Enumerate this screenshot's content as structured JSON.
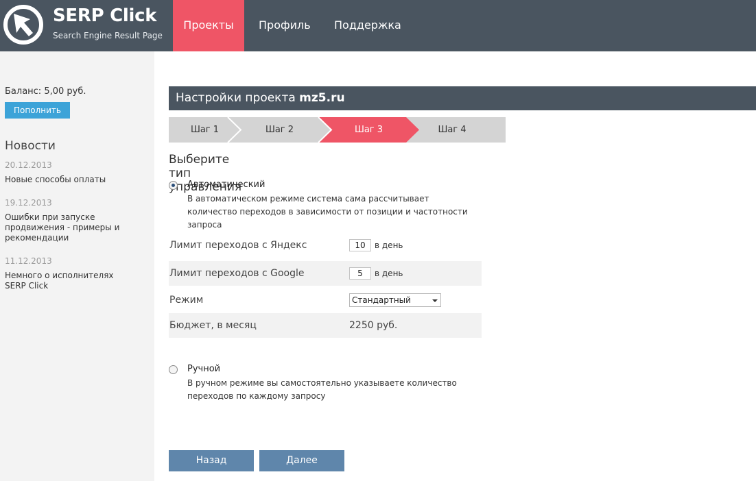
{
  "header": {
    "logo_title": "SERP Click",
    "logo_subtitle": "Search Engine Result Page",
    "nav": [
      {
        "label": "Проекты",
        "active": true
      },
      {
        "label": "Профиль",
        "active": false
      },
      {
        "label": "Поддержка",
        "active": false
      }
    ]
  },
  "sidebar": {
    "balance": "Баланс:  5,00 руб.",
    "topup_label": "Пополнить",
    "news_title": "Новости",
    "news": [
      {
        "date": "20.12.2013",
        "text": "Новые способы оплаты"
      },
      {
        "date": "19.12.2013",
        "text": "Ошибки при запуске продвижения - примеры и рекомендации"
      },
      {
        "date": "11.12.2013",
        "text": "Немного о исполнителях SERP Click"
      }
    ]
  },
  "main": {
    "settings_prefix": "Настройки проекта",
    "project_name": "mz5.ru",
    "steps": [
      {
        "label": "Шаг 1",
        "active": false
      },
      {
        "label": "Шаг 2",
        "active": false
      },
      {
        "label": "Шаг 3",
        "active": true
      },
      {
        "label": "Шаг 4",
        "active": false
      }
    ],
    "section_title": "Выберите тип управления",
    "auto": {
      "label": "Автоматический",
      "checked": true,
      "description": "В автоматическом режиме система сама рассчитывает количество переходов в зависимости от позиции и частотности запроса"
    },
    "form": {
      "yandex_label": "Лимит переходов с Яндекс",
      "yandex_value": "10",
      "google_label": "Лимит переходов с Google",
      "google_value": "5",
      "per_day": "в день",
      "mode_label": "Режим",
      "mode_value": "Стандартный",
      "budget_label": "Бюджет, в месяц",
      "budget_value": "2250 руб."
    },
    "manual": {
      "label": "Ручной",
      "checked": false,
      "description": "В ручном режиме вы самостоятельно указываете количество переходов по каждому запросу"
    },
    "back_label": "Назад",
    "next_label": "Далее"
  },
  "colors": {
    "header_bg": "#4a5560",
    "accent": "#ef5566",
    "topup_button": "#3ca3d8",
    "nav_buttons": "#5f86ab"
  },
  "icons": {
    "logo": "hammer-sickle-cursor-icon",
    "select_caret": "caret-down-icon"
  }
}
